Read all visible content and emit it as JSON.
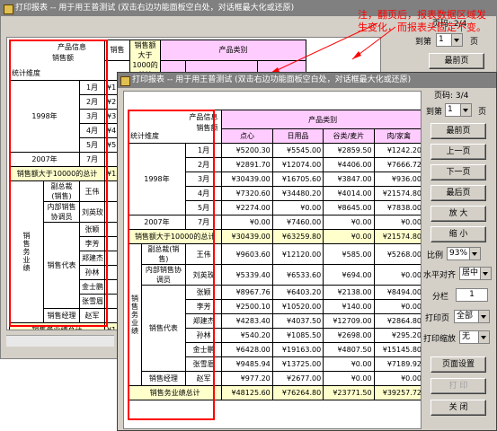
{
  "back_window": {
    "title": "打印报表 -- 用于用王普测试 (双击右边功能面板空白处，对话框最大化或还原)",
    "page_label": "页码: 2/4",
    "goto_label": "到第",
    "goto_value": "1",
    "page_suffix": "页",
    "first_btn": "最前页",
    "corner_top": "产品信息",
    "corner_mid": "销售额",
    "corner_left": "统计维度",
    "hdr_sale": "销售",
    "hdr_over": "销售额大于1000的总计",
    "hdr_cat": "产品类别",
    "year": "1998年",
    "months": [
      "1月",
      "2月",
      "3月",
      "4月",
      "5月"
    ],
    "months_cut": [
      "¥1",
      "¥2",
      "¥3",
      "¥4",
      "¥5"
    ],
    "y2007": "2007年",
    "m7": "7月",
    "over_total": "销售额大于10000的总计",
    "over_cut": "¥15",
    "biz_label": "销售务业绩",
    "rep_group": "销售代表",
    "cat_ref": "副总裁(销售)",
    "cat_ref_name": "王伟",
    "cat_coord": "内部销售协调员",
    "cat_coord_name": "刘英玫",
    "reps": [
      "张颖",
      "李芳",
      "郑建杰",
      "孙林",
      "金士鹏"
    ],
    "rep7": "张雪眉",
    "mgr_label": "销售经理",
    "mgr_name": "赵军",
    "total_label": "销售务业绩总计",
    "total_cut": "¥15"
  },
  "front_window": {
    "title": "打印报表 -- 用于用王普测试 (双击右边功能面板空白处，对话框最大化或还原)",
    "page_label": "页码: 3/4",
    "goto_label": "到第",
    "goto_value": "1",
    "page_suffix": "页",
    "buttons": {
      "first": "最前页",
      "prev": "上一页",
      "next": "下一页",
      "last": "最后页",
      "zoom_in": "放 大",
      "zoom_out": "缩 小",
      "page_setup": "页面设置",
      "print": "打 印",
      "close": "关 闭"
    },
    "scale_label": "比例",
    "scale_value": "93%",
    "halign_label": "水平对齐",
    "halign_value": "居中",
    "columns_label": "分栏",
    "columns_value": "1",
    "print_page_label": "打印页",
    "print_page_value": "全部",
    "print_scale_label": "打印缩放",
    "print_scale_value": "无",
    "table": {
      "corner_top": "产品信息",
      "corner_mid": "销售额",
      "corner_left": "统计维度",
      "cat_header": "产品类别",
      "cols": [
        "点心",
        "日用品",
        "谷类/麦片",
        "肉/家禽"
      ],
      "year": "1998年",
      "y2007": "2007年",
      "over_total": "销售额大于10000的总计",
      "biz_label": "销售务业绩",
      "rep_group": "销售代表",
      "mgr_label": "销售经理",
      "total_label": "销售务业绩总计",
      "rows": [
        {
          "label": "1月",
          "vals": [
            "¥5200.30",
            "¥5545.00",
            "¥2859.50",
            "¥1242.20"
          ]
        },
        {
          "label": "2月",
          "vals": [
            "¥2891.70",
            "¥12074.00",
            "¥4406.00",
            "¥7666.72"
          ]
        },
        {
          "label": "3月",
          "vals": [
            "¥30439.00",
            "¥16705.60",
            "¥3847.00",
            "¥936.00"
          ]
        },
        {
          "label": "4月",
          "vals": [
            "¥7320.60",
            "¥34480.20",
            "¥4014.00",
            "¥21574.80"
          ]
        },
        {
          "label": "5月",
          "vals": [
            "¥2274.00",
            "¥0.00",
            "¥8645.00",
            "¥7838.00"
          ]
        },
        {
          "label": "7月",
          "vals": [
            "¥0.00",
            "¥7460.00",
            "¥0.00",
            "¥0.00"
          ]
        },
        {
          "label": "",
          "vals": [
            "¥30439.00",
            "¥63259.80",
            "¥0.00",
            "¥21574.80"
          ]
        },
        {
          "label": "王伟",
          "group": "副总裁(销售)",
          "vals": [
            "¥9603.60",
            "¥12120.00",
            "¥585.00",
            "¥5268.00"
          ]
        },
        {
          "label": "刘英玫",
          "group": "内部销售协调员",
          "vals": [
            "¥5339.40",
            "¥6533.60",
            "¥694.00",
            "¥0.00"
          ]
        },
        {
          "label": "张颖",
          "vals": [
            "¥8967.76",
            "¥6403.20",
            "¥2138.00",
            "¥8494.00"
          ]
        },
        {
          "label": "李芳",
          "vals": [
            "¥2500.10",
            "¥10520.00",
            "¥140.00",
            "¥0.00"
          ]
        },
        {
          "label": "郑建杰",
          "vals": [
            "¥4283.40",
            "¥4037.50",
            "¥12709.00",
            "¥2864.80"
          ]
        },
        {
          "label": "孙林",
          "vals": [
            "¥540.20",
            "¥1085.50",
            "¥2698.00",
            "¥295.20"
          ]
        },
        {
          "label": "金士鹏",
          "vals": [
            "¥6428.00",
            "¥19163.00",
            "¥4807.50",
            "¥15145.80"
          ]
        },
        {
          "label": "张雪眉",
          "vals": [
            "¥9485.94",
            "¥13725.00",
            "¥0.00",
            "¥7189.92"
          ]
        },
        {
          "label": "赵军",
          "vals": [
            "¥977.20",
            "¥2677.00",
            "¥0.00",
            "¥0.00"
          ]
        },
        {
          "label": "",
          "vals": [
            "¥48125.60",
            "¥76264.80",
            "¥23771.50",
            "¥39257.72"
          ]
        }
      ]
    }
  },
  "annotation": {
    "text": "注，翻页后，报表数据区域发生变化，而报表头固定不变。"
  },
  "colors": {
    "title_active": "#0a246a",
    "title_inactive": "#808080",
    "header_pink": "#ffccff",
    "row_yellow": "#ffffcc",
    "highlight_red": "#ff0000"
  }
}
